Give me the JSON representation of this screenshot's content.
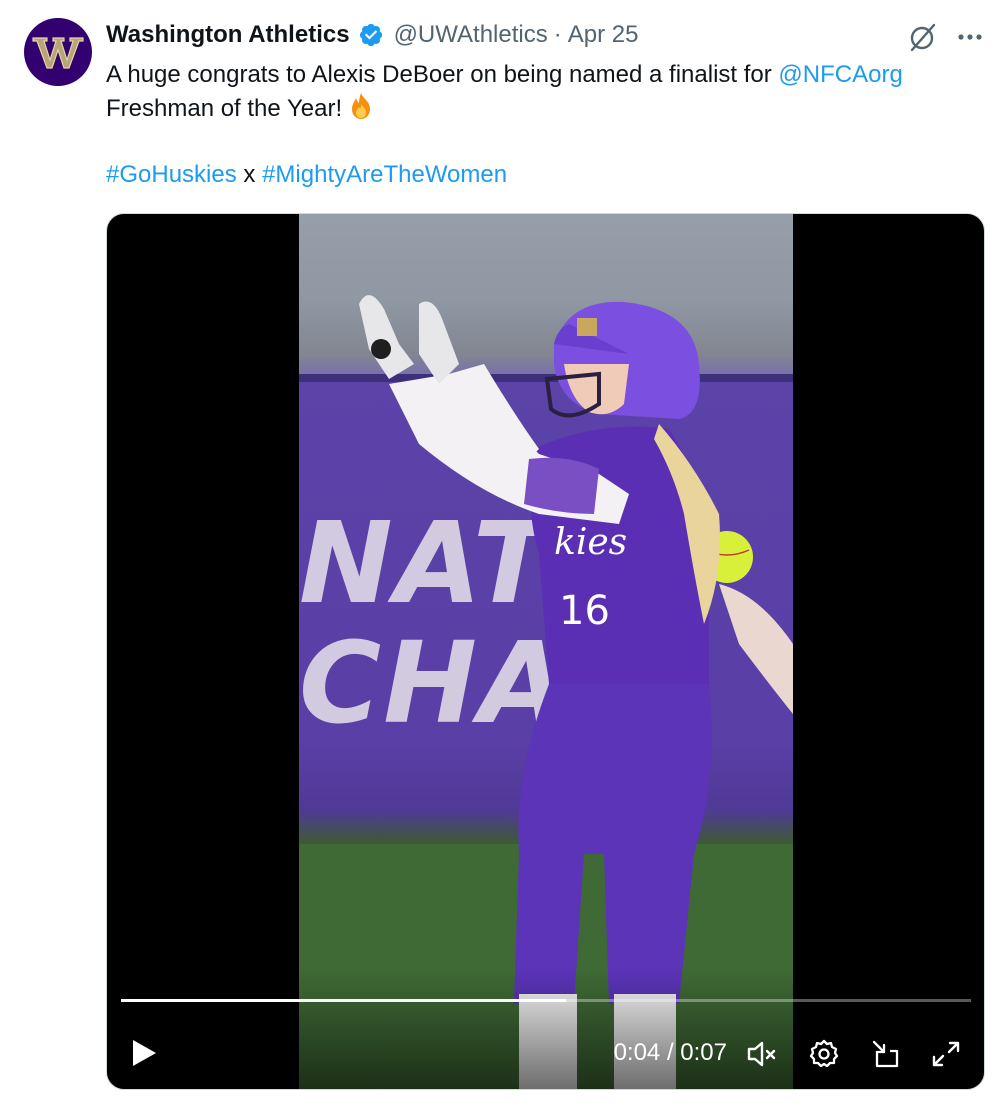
{
  "tweet": {
    "author": {
      "display_name": "Washington Athletics",
      "handle": "@UWAthletics",
      "separator": "·",
      "date": "Apr 25",
      "verified": true,
      "avatar_icon": "uw-w-logo",
      "avatar_color": "#33006f"
    },
    "text": {
      "line1_prefix": "A huge congrats to Alexis DeBoer on being named a finalist for ",
      "mention": "@NFCAorg",
      "line2_text": "Freshman of the Year!",
      "emoji": "fire",
      "hashtag1": "#GoHuskies",
      "joiner": " x ",
      "hashtag2": "#MightyAreTheWomen"
    },
    "actions": {
      "grok_icon": "grok-icon",
      "more_icon": "more-icon"
    },
    "media": {
      "type": "video",
      "background_text": [
        "NATI",
        "CHA"
      ],
      "player": {
        "progress": 0.523,
        "current_time": "0:04",
        "duration": "0:07",
        "time_display": "0:04 / 0:07",
        "state": "paused",
        "muted": true
      }
    },
    "colors": {
      "link": "#1d9bf0",
      "text": "#0f1419",
      "secondary": "#536471",
      "verified": "#1d9bf0"
    }
  }
}
